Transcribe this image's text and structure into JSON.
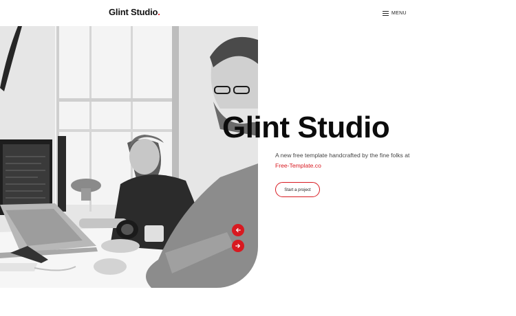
{
  "header": {
    "logo_text": "Glint Studio",
    "logo_dot": ".",
    "menu_label": "MENU",
    "menu_icon": "hamburger-icon"
  },
  "hero": {
    "image_alt": "Two developers working at desks with laptops",
    "title": "Glint Studio",
    "description": "A new free template handcrafted by the fine folks at",
    "link_text": "Free-Template.co",
    "cta_label": "Start a project",
    "prev_icon": "arrow-left-icon",
    "next_icon": "arrow-right-icon"
  },
  "colors": {
    "accent": "#d81920",
    "text": "#111111",
    "background": "#ffffff"
  }
}
